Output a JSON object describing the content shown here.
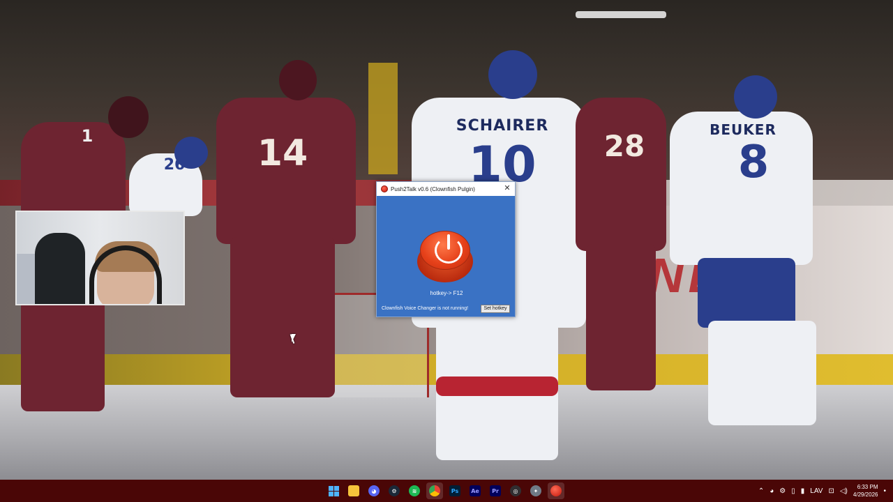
{
  "dialog": {
    "title": "Push2Talk v0.6 (Clownfish Pulgin)",
    "close_label": "✕",
    "hotkey_text": "hotkey-> F12",
    "status_text": "Clownfish Voice Changer is not running!",
    "set_hotkey_label": "Set hotkey"
  },
  "scene": {
    "players": [
      {
        "name": "SCHAIRER",
        "number": "10"
      },
      {
        "name": "BEUKER",
        "number": "8"
      },
      {
        "name": "",
        "number": "14"
      },
      {
        "name": "",
        "number": "26"
      },
      {
        "name": "",
        "number": "28"
      },
      {
        "name": "",
        "number": "1"
      }
    ],
    "sign_text": "NDA"
  },
  "taskbar": {
    "apps": [
      {
        "id": "start",
        "icon": "windows-start-icon"
      },
      {
        "id": "file-explorer",
        "icon": "folder-icon",
        "color": "#f5c33b"
      },
      {
        "id": "discord",
        "icon": "discord-icon",
        "color": "#5865f2"
      },
      {
        "id": "steam",
        "icon": "steam-icon",
        "color": "#1b2838"
      },
      {
        "id": "spotify",
        "icon": "spotify-icon",
        "color": "#1db954"
      },
      {
        "id": "chrome",
        "icon": "chrome-icon",
        "color": "#4285f4"
      },
      {
        "id": "photoshop",
        "icon": "photoshop-icon",
        "label": "Ps",
        "color": "#001e36"
      },
      {
        "id": "after-effects",
        "icon": "after-effects-icon",
        "label": "Ae",
        "color": "#00005b"
      },
      {
        "id": "premiere",
        "icon": "premiere-icon",
        "label": "Pr",
        "color": "#00005b"
      },
      {
        "id": "obs",
        "icon": "obs-icon",
        "color": "#302e31"
      },
      {
        "id": "settings",
        "icon": "gear-icon",
        "color": "#6f7a86"
      },
      {
        "id": "push2talk",
        "icon": "push2talk-icon",
        "color": "#d8281a"
      }
    ],
    "tray": {
      "language": "LAV",
      "time": "6:33 PM",
      "date": "4/29/2026"
    }
  }
}
